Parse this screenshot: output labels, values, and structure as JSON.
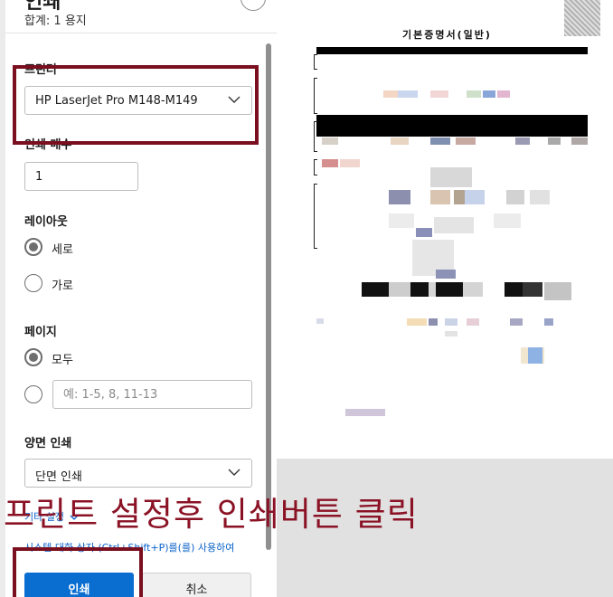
{
  "dialog": {
    "title": "인쇄",
    "total": "합계: 1 용지",
    "printer_label": "프린터",
    "printer_value": "HP LaserJet Pro M148-M149",
    "copies_label": "인쇄 매수",
    "copies_value": "1",
    "layout_label": "레이아웃",
    "layout_options": [
      "세로",
      "가로"
    ],
    "layout_selected": "세로",
    "pages_label": "페이지",
    "pages_all": "모두",
    "pages_placeholder": "예: 1-5, 8, 11-13",
    "duplex_label": "양면 인쇄",
    "duplex_value": "단면 인쇄",
    "more_settings": "기타 설정",
    "system_dialog": "시스템 대화 상자 (Ctrl+Shift+P)를(를) 사용하여",
    "print_button": "인쇄",
    "cancel_button": "취소"
  },
  "annotation": {
    "text": "프린트 설정후 인쇄버튼 클릭",
    "color": "#8a1224"
  },
  "preview": {
    "doc_title": "기본증명서(일반)"
  },
  "colors": {
    "accent": "#0a6ed1",
    "annotation_box": "#7a0f1f"
  }
}
